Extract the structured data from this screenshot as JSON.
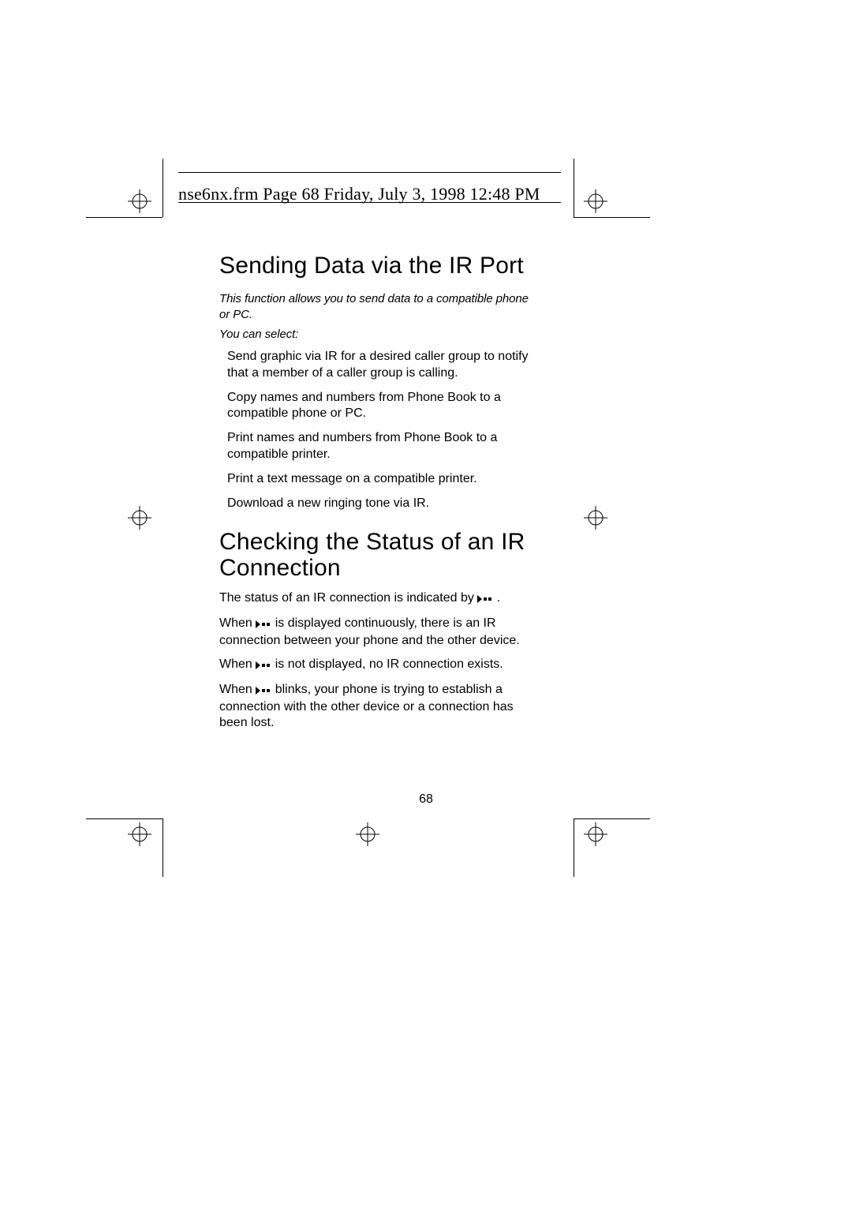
{
  "header": {
    "text": "nse6nx.frm  Page 68  Friday, July 3, 1998  12:48 PM"
  },
  "section1": {
    "title": "Sending Data via the IR Port",
    "intro": "This function allows you to send data to a compatible phone or PC.",
    "lead": "You can select:",
    "items": [
      "Send graphic via IR for a desired caller group to notify that a member of a caller group is calling.",
      "Copy names and numbers from Phone Book to a compatible phone or PC.",
      "Print names and numbers from Phone Book to a compatible printer.",
      "Print a text message on a compatible printer.",
      "Download a new ringing tone via IR."
    ]
  },
  "section2": {
    "title": "Checking the Status of an IR Connection",
    "p1a": "The status of an IR connection is indicated by ",
    "p1b": ".",
    "p2a": "When ",
    "p2b": " is displayed continuously, there is an IR connection be­tween your phone and the other device.",
    "p3a": "When ",
    "p3b": " is not displayed, no IR connection exists.",
    "p4a": "When ",
    "p4b": " blinks, your phone is trying to establish a connection with the other device or a connection has been lost."
  },
  "page_number": "68"
}
